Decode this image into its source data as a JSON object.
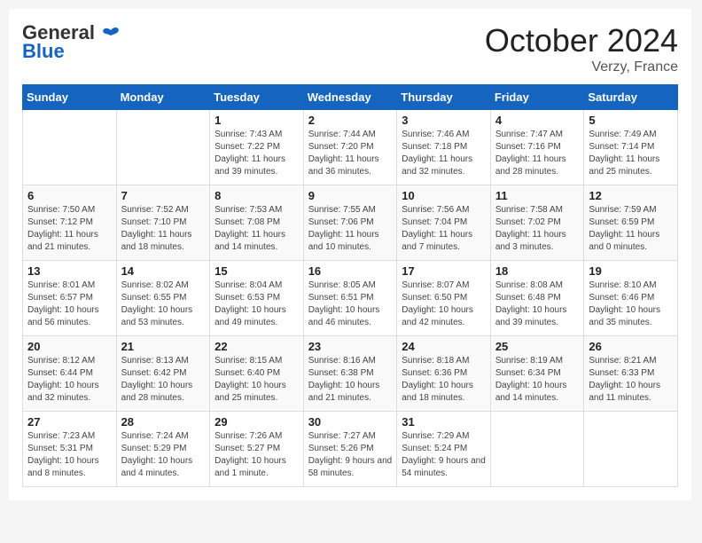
{
  "header": {
    "logo_general": "General",
    "logo_blue": "Blue",
    "month_title": "October 2024",
    "location": "Verzy, France"
  },
  "weekdays": [
    "Sunday",
    "Monday",
    "Tuesday",
    "Wednesday",
    "Thursday",
    "Friday",
    "Saturday"
  ],
  "weeks": [
    [
      {
        "day": "",
        "info": ""
      },
      {
        "day": "",
        "info": ""
      },
      {
        "day": "1",
        "info": "Sunrise: 7:43 AM\nSunset: 7:22 PM\nDaylight: 11 hours and 39 minutes."
      },
      {
        "day": "2",
        "info": "Sunrise: 7:44 AM\nSunset: 7:20 PM\nDaylight: 11 hours and 36 minutes."
      },
      {
        "day": "3",
        "info": "Sunrise: 7:46 AM\nSunset: 7:18 PM\nDaylight: 11 hours and 32 minutes."
      },
      {
        "day": "4",
        "info": "Sunrise: 7:47 AM\nSunset: 7:16 PM\nDaylight: 11 hours and 28 minutes."
      },
      {
        "day": "5",
        "info": "Sunrise: 7:49 AM\nSunset: 7:14 PM\nDaylight: 11 hours and 25 minutes."
      }
    ],
    [
      {
        "day": "6",
        "info": "Sunrise: 7:50 AM\nSunset: 7:12 PM\nDaylight: 11 hours and 21 minutes."
      },
      {
        "day": "7",
        "info": "Sunrise: 7:52 AM\nSunset: 7:10 PM\nDaylight: 11 hours and 18 minutes."
      },
      {
        "day": "8",
        "info": "Sunrise: 7:53 AM\nSunset: 7:08 PM\nDaylight: 11 hours and 14 minutes."
      },
      {
        "day": "9",
        "info": "Sunrise: 7:55 AM\nSunset: 7:06 PM\nDaylight: 11 hours and 10 minutes."
      },
      {
        "day": "10",
        "info": "Sunrise: 7:56 AM\nSunset: 7:04 PM\nDaylight: 11 hours and 7 minutes."
      },
      {
        "day": "11",
        "info": "Sunrise: 7:58 AM\nSunset: 7:02 PM\nDaylight: 11 hours and 3 minutes."
      },
      {
        "day": "12",
        "info": "Sunrise: 7:59 AM\nSunset: 6:59 PM\nDaylight: 11 hours and 0 minutes."
      }
    ],
    [
      {
        "day": "13",
        "info": "Sunrise: 8:01 AM\nSunset: 6:57 PM\nDaylight: 10 hours and 56 minutes."
      },
      {
        "day": "14",
        "info": "Sunrise: 8:02 AM\nSunset: 6:55 PM\nDaylight: 10 hours and 53 minutes."
      },
      {
        "day": "15",
        "info": "Sunrise: 8:04 AM\nSunset: 6:53 PM\nDaylight: 10 hours and 49 minutes."
      },
      {
        "day": "16",
        "info": "Sunrise: 8:05 AM\nSunset: 6:51 PM\nDaylight: 10 hours and 46 minutes."
      },
      {
        "day": "17",
        "info": "Sunrise: 8:07 AM\nSunset: 6:50 PM\nDaylight: 10 hours and 42 minutes."
      },
      {
        "day": "18",
        "info": "Sunrise: 8:08 AM\nSunset: 6:48 PM\nDaylight: 10 hours and 39 minutes."
      },
      {
        "day": "19",
        "info": "Sunrise: 8:10 AM\nSunset: 6:46 PM\nDaylight: 10 hours and 35 minutes."
      }
    ],
    [
      {
        "day": "20",
        "info": "Sunrise: 8:12 AM\nSunset: 6:44 PM\nDaylight: 10 hours and 32 minutes."
      },
      {
        "day": "21",
        "info": "Sunrise: 8:13 AM\nSunset: 6:42 PM\nDaylight: 10 hours and 28 minutes."
      },
      {
        "day": "22",
        "info": "Sunrise: 8:15 AM\nSunset: 6:40 PM\nDaylight: 10 hours and 25 minutes."
      },
      {
        "day": "23",
        "info": "Sunrise: 8:16 AM\nSunset: 6:38 PM\nDaylight: 10 hours and 21 minutes."
      },
      {
        "day": "24",
        "info": "Sunrise: 8:18 AM\nSunset: 6:36 PM\nDaylight: 10 hours and 18 minutes."
      },
      {
        "day": "25",
        "info": "Sunrise: 8:19 AM\nSunset: 6:34 PM\nDaylight: 10 hours and 14 minutes."
      },
      {
        "day": "26",
        "info": "Sunrise: 8:21 AM\nSunset: 6:33 PM\nDaylight: 10 hours and 11 minutes."
      }
    ],
    [
      {
        "day": "27",
        "info": "Sunrise: 7:23 AM\nSunset: 5:31 PM\nDaylight: 10 hours and 8 minutes."
      },
      {
        "day": "28",
        "info": "Sunrise: 7:24 AM\nSunset: 5:29 PM\nDaylight: 10 hours and 4 minutes."
      },
      {
        "day": "29",
        "info": "Sunrise: 7:26 AM\nSunset: 5:27 PM\nDaylight: 10 hours and 1 minute."
      },
      {
        "day": "30",
        "info": "Sunrise: 7:27 AM\nSunset: 5:26 PM\nDaylight: 9 hours and 58 minutes."
      },
      {
        "day": "31",
        "info": "Sunrise: 7:29 AM\nSunset: 5:24 PM\nDaylight: 9 hours and 54 minutes."
      },
      {
        "day": "",
        "info": ""
      },
      {
        "day": "",
        "info": ""
      }
    ]
  ]
}
